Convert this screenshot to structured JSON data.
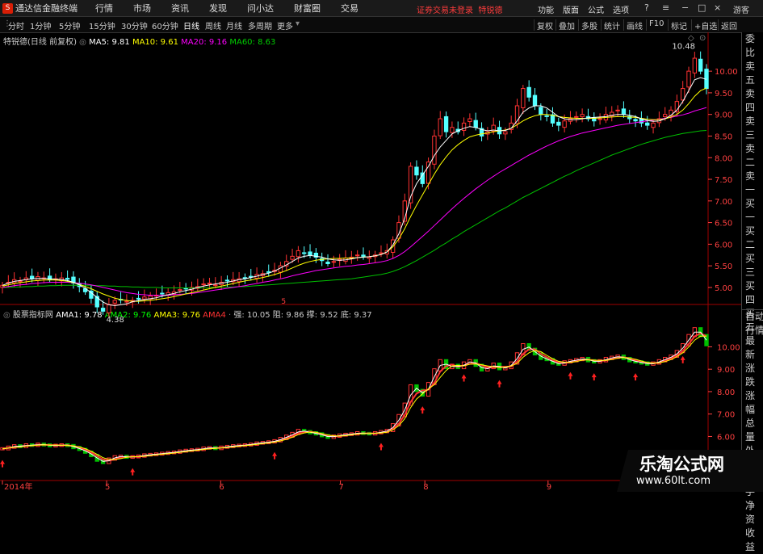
{
  "app": {
    "title": "通达信金融终端",
    "logo": "S"
  },
  "menu": [
    "行情",
    "市场",
    "资讯",
    "发现",
    "问小达",
    "财富圈",
    "交易"
  ],
  "notice": "证券交易未登录",
  "stock_name": "特锐德",
  "top_right": [
    "功能",
    "版面",
    "公式",
    "选项"
  ],
  "guest": "游客",
  "periods": [
    "分时",
    "1分钟",
    "5分钟",
    "15分钟",
    "30分钟",
    "60分钟",
    "日线",
    "周线",
    "月线",
    "多周期",
    "更多"
  ],
  "active_period": "日线",
  "right_tools": [
    "复权",
    "叠加",
    "多股",
    "统计",
    "画线",
    "F10",
    "标记",
    "+自选",
    "返回"
  ],
  "main_legend": {
    "title": "特锐德(日线 前复权)",
    "ma5": "MA5: 9.81",
    "ma10": "MA10: 9.61",
    "ma20": "MA20: 9.16",
    "ma60": "MA60: 8.63"
  },
  "sub_legend": {
    "title": "股票指标网",
    "ama1": "AMA1: 9.78",
    "ama2": "AMA2: 9.76",
    "ama3": "AMA3: 9.76",
    "ama4": "AMA4",
    "strong": "强: 10.05",
    "resist": "阻: 9.86",
    "hold": "撑: 9.52",
    "bottom": "底: 9.37"
  },
  "side_panel": [
    "委比",
    "卖五",
    "卖四",
    "卖三",
    "卖二",
    "卖一",
    "买一",
    "买二",
    "买三",
    "买四",
    "买五",
    "最新",
    "涨跌",
    "涨幅",
    "总量",
    "外盘",
    "换手",
    "净资",
    "收益"
  ],
  "side_panel_bottom": [
    "自动",
    "行情"
  ],
  "annotations": {
    "high": "10.48",
    "low": "4.38",
    "marker": "5"
  },
  "watermark": {
    "cn": "乐淘公式网",
    "url": "www.60lt.com"
  },
  "colors": {
    "up": "#ff3232",
    "down": "#54ffff",
    "ma5": "#ffffff",
    "ma10": "#ffff00",
    "ma20": "#ff00ff",
    "ma60": "#00c000",
    "axis": "#ff4040"
  },
  "chart_data": [
    {
      "type": "candlestick",
      "title": "特锐德(日线 前复权)",
      "y_ticks": [
        "10.00",
        "9.50",
        "9.00",
        "8.50",
        "8.00",
        "7.50",
        "7.00",
        "6.50",
        "6.00",
        "5.50",
        "5.00"
      ],
      "ylim": [
        4.7,
        10.6
      ],
      "x_ticks": [
        "2014年",
        "5",
        "6",
        "7",
        "8",
        "9"
      ],
      "close": [
        5.05,
        5.12,
        5.18,
        5.15,
        5.22,
        5.2,
        5.25,
        5.22,
        5.18,
        5.2,
        5.22,
        5.19,
        5.1,
        5.02,
        4.9,
        4.75,
        4.55,
        4.45,
        4.6,
        4.7,
        4.72,
        4.68,
        4.7,
        4.73,
        4.78,
        4.8,
        4.82,
        4.85,
        4.88,
        4.9,
        4.95,
        4.98,
        5.0,
        5.02,
        5.08,
        5.1,
        5.06,
        5.12,
        5.15,
        5.18,
        5.2,
        5.22,
        5.25,
        5.3,
        5.32,
        5.35,
        5.4,
        5.5,
        5.6,
        5.72,
        5.85,
        5.8,
        5.75,
        5.7,
        5.62,
        5.55,
        5.6,
        5.65,
        5.68,
        5.7,
        5.75,
        5.72,
        5.7,
        5.75,
        5.8,
        5.85,
        6.1,
        6.5,
        7.0,
        7.8,
        7.6,
        7.4,
        7.9,
        8.5,
        8.9,
        8.6,
        8.7,
        8.6,
        8.8,
        8.9,
        8.7,
        8.5,
        8.6,
        8.75,
        8.55,
        8.6,
        8.8,
        9.2,
        9.6,
        9.4,
        9.2,
        9.0,
        8.95,
        8.8,
        8.75,
        8.85,
        8.9,
        8.95,
        9.0,
        8.9,
        8.85,
        8.9,
        9.0,
        9.05,
        9.1,
        9.0,
        8.9,
        8.85,
        8.8,
        8.75,
        8.8,
        8.9,
        9.0,
        9.1,
        9.3,
        9.6,
        10.0,
        10.3,
        10.0,
        9.6
      ],
      "ma5": [
        5.05,
        5.1,
        5.14,
        5.16,
        5.18,
        5.2,
        5.21,
        5.21,
        5.2,
        5.19,
        5.18,
        5.16,
        5.12,
        5.06,
        4.98,
        4.88,
        4.77,
        4.66,
        4.6,
        4.58,
        4.6,
        4.62,
        4.67,
        4.7,
        4.72,
        4.74,
        4.76,
        4.8,
        4.83,
        4.86,
        4.9,
        4.93,
        4.96,
        5.0,
        5.03,
        5.06,
        5.08,
        5.1,
        5.12,
        5.15,
        5.18,
        5.2,
        5.23,
        5.26,
        5.3,
        5.33,
        5.38,
        5.45,
        5.52,
        5.6,
        5.68,
        5.72,
        5.74,
        5.72,
        5.7,
        5.66,
        5.64,
        5.63,
        5.64,
        5.66,
        5.69,
        5.7,
        5.71,
        5.73,
        5.76,
        5.82,
        5.98,
        6.24,
        6.6,
        7.1,
        7.4,
        7.6,
        7.8,
        8.05,
        8.25,
        8.4,
        8.55,
        8.62,
        8.68,
        8.72,
        8.7,
        8.65,
        8.62,
        8.64,
        8.62,
        8.63,
        8.68,
        8.85,
        9.05,
        9.15,
        9.2,
        9.2,
        9.15,
        9.05,
        8.95,
        8.9,
        8.88,
        8.88,
        8.9,
        8.92,
        8.93,
        8.94,
        8.95,
        8.98,
        9.0,
        9.0,
        8.98,
        8.95,
        8.9,
        8.86,
        8.84,
        8.85,
        8.9,
        8.98,
        9.1,
        9.3,
        9.55,
        9.8,
        9.85,
        9.81
      ],
      "ma10": [
        5.03,
        5.06,
        5.09,
        5.11,
        5.13,
        5.15,
        5.16,
        5.17,
        5.17,
        5.17,
        5.16,
        5.14,
        5.11,
        5.07,
        5.02,
        4.97,
        4.91,
        4.85,
        4.8,
        4.75,
        4.72,
        4.7,
        4.68,
        4.68,
        4.69,
        4.7,
        4.72,
        4.74,
        4.76,
        4.79,
        4.82,
        4.85,
        4.88,
        4.91,
        4.94,
        4.97,
        5.0,
        5.03,
        5.06,
        5.09,
        5.12,
        5.15,
        5.17,
        5.2,
        5.23,
        5.26,
        5.3,
        5.34,
        5.39,
        5.45,
        5.51,
        5.56,
        5.6,
        5.63,
        5.65,
        5.66,
        5.67,
        5.67,
        5.68,
        5.68,
        5.69,
        5.7,
        5.71,
        5.73,
        5.76,
        5.82,
        5.94,
        6.12,
        6.36,
        6.64,
        6.9,
        7.14,
        7.38,
        7.62,
        7.84,
        8.02,
        8.18,
        8.3,
        8.4,
        8.48,
        8.52,
        8.55,
        8.57,
        8.6,
        8.62,
        8.64,
        8.68,
        8.76,
        8.85,
        8.92,
        8.97,
        9.0,
        9.0,
        8.98,
        8.95,
        8.93,
        8.92,
        8.91,
        8.91,
        8.91,
        8.91,
        8.92,
        8.93,
        8.94,
        8.95,
        8.95,
        8.94,
        8.93,
        8.91,
        8.89,
        8.88,
        8.88,
        8.9,
        8.94,
        9.0,
        9.1,
        9.25,
        9.42,
        9.55,
        9.61
      ],
      "ma20": [
        5.0,
        5.02,
        5.04,
        5.06,
        5.07,
        5.09,
        5.1,
        5.11,
        5.12,
        5.12,
        5.12,
        5.12,
        5.11,
        5.1,
        5.08,
        5.06,
        5.03,
        5.0,
        4.97,
        4.94,
        4.91,
        4.88,
        4.86,
        4.84,
        4.83,
        4.82,
        4.82,
        4.82,
        4.82,
        4.83,
        4.84,
        4.85,
        4.86,
        4.88,
        4.9,
        4.92,
        4.94,
        4.96,
        4.98,
        5.0,
        5.02,
        5.04,
        5.07,
        5.09,
        5.12,
        5.14,
        5.17,
        5.2,
        5.23,
        5.27,
        5.3,
        5.33,
        5.36,
        5.39,
        5.41,
        5.43,
        5.45,
        5.47,
        5.49,
        5.5,
        5.52,
        5.53,
        5.55,
        5.57,
        5.59,
        5.62,
        5.67,
        5.74,
        5.83,
        5.94,
        6.06,
        6.18,
        6.3,
        6.43,
        6.56,
        6.69,
        6.82,
        6.94,
        7.06,
        7.17,
        7.28,
        7.38,
        7.48,
        7.57,
        7.66,
        7.74,
        7.82,
        7.9,
        7.98,
        8.06,
        8.13,
        8.2,
        8.27,
        8.33,
        8.39,
        8.44,
        8.49,
        8.53,
        8.57,
        8.6,
        8.63,
        8.66,
        8.69,
        8.72,
        8.75,
        8.77,
        8.79,
        8.81,
        8.83,
        8.85,
        8.87,
        8.89,
        8.91,
        8.93,
        8.96,
        8.99,
        9.03,
        9.08,
        9.12,
        9.16
      ],
      "ma60": [
        5.0,
        5.0,
        5.01,
        5.01,
        5.02,
        5.02,
        5.03,
        5.03,
        5.04,
        5.04,
        5.05,
        5.05,
        5.05,
        5.05,
        5.05,
        5.05,
        5.04,
        5.04,
        5.03,
        5.03,
        5.02,
        5.02,
        5.01,
        5.01,
        5.0,
        5.0,
        5.0,
        4.99,
        4.99,
        4.99,
        4.99,
        4.99,
        4.99,
        4.99,
        4.99,
        5.0,
        5.0,
        5.0,
        5.01,
        5.01,
        5.02,
        5.02,
        5.03,
        5.04,
        5.05,
        5.06,
        5.07,
        5.08,
        5.09,
        5.1,
        5.11,
        5.12,
        5.13,
        5.14,
        5.15,
        5.16,
        5.17,
        5.18,
        5.19,
        5.2,
        5.22,
        5.24,
        5.26,
        5.28,
        5.3,
        5.33,
        5.37,
        5.42,
        5.48,
        5.55,
        5.62,
        5.7,
        5.78,
        5.86,
        5.95,
        6.03,
        6.12,
        6.2,
        6.29,
        6.37,
        6.45,
        6.53,
        6.61,
        6.69,
        6.77,
        6.84,
        6.92,
        7.0,
        7.08,
        7.15,
        7.22,
        7.29,
        7.36,
        7.43,
        7.5,
        7.57,
        7.63,
        7.7,
        7.76,
        7.82,
        7.88,
        7.94,
        8.0,
        8.06,
        8.11,
        8.16,
        8.21,
        8.26,
        8.31,
        8.35,
        8.39,
        8.43,
        8.47,
        8.5,
        8.53,
        8.56,
        8.58,
        8.6,
        8.62,
        8.63
      ]
    },
    {
      "type": "line",
      "title": "股票指标网",
      "y_ticks": [
        "10.00",
        "9.00",
        "8.00",
        "7.00",
        "6.00"
      ],
      "ylim": [
        5.8,
        10.7
      ],
      "signal_count": 11
    }
  ]
}
